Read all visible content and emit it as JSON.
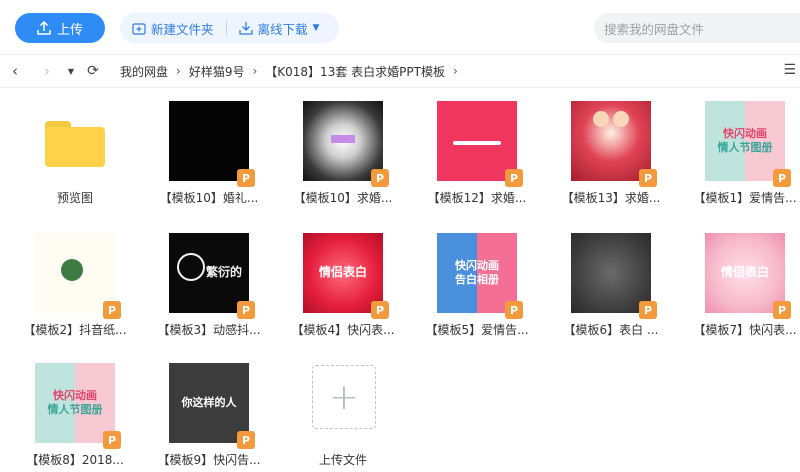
{
  "toolbar": {
    "upload_label": "上传",
    "new_folder_label": "新建文件夹",
    "offline_download_label": "离线下载",
    "search_placeholder": "搜索我的网盘文件"
  },
  "breadcrumb": [
    "我的网盘",
    "好样猫9号",
    "【K018】13套 表白求婚PPT模板"
  ],
  "items": [
    {
      "name": "预览图",
      "type": "folder"
    },
    {
      "name": "【模板10】婚礼...",
      "type": "ppt"
    },
    {
      "name": "【模板10】求婚...",
      "type": "ppt"
    },
    {
      "name": "【模板12】求婚...",
      "type": "ppt"
    },
    {
      "name": "【模板13】求婚...",
      "type": "ppt"
    },
    {
      "name": "【模板1】爱情告...",
      "type": "ppt"
    },
    {
      "name": "【模板2】抖音纸...",
      "type": "ppt"
    },
    {
      "name": "【模板3】动感抖...",
      "type": "ppt"
    },
    {
      "name": "【模板4】快闪表...",
      "type": "ppt"
    },
    {
      "name": "【模板5】爱情告...",
      "type": "ppt"
    },
    {
      "name": "【模板6】表白 ...",
      "type": "ppt"
    },
    {
      "name": "【模板7】快闪表...",
      "type": "ppt"
    },
    {
      "name": "【模板8】2018...",
      "type": "ppt"
    },
    {
      "name": "【模板9】快闪告...",
      "type": "ppt"
    },
    {
      "name": "上传文件",
      "type": "upload"
    }
  ],
  "thumb_text": {
    "t4": "情侣表白",
    "t5_line1": "快闪动画",
    "t5_line2": "告白相册",
    "t7": "情侣表白",
    "t1_line1": "快闪动画",
    "t1_line2": "情人节图册",
    "t8_line1": "快闪动画",
    "t8_line2": "情人节图册",
    "t9": "你这样的人",
    "t3": "繁衍的"
  },
  "badge_letter": "P",
  "colors": {
    "accent": "#2f8cf5",
    "ppt_badge": "#f39a3c",
    "folder": "#ffd24a"
  }
}
